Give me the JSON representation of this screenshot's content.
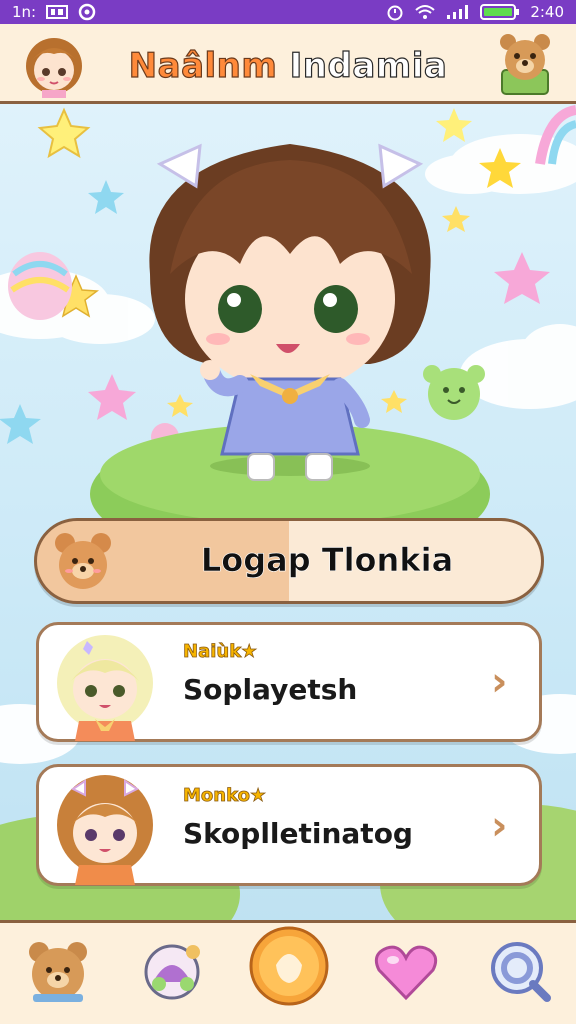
{
  "status_bar": {
    "left_text": "1n:",
    "time": "2:40"
  },
  "header": {
    "title_part1": "Naâlnm",
    "title_part2": "Indamia"
  },
  "primary_button": {
    "label": "Logap Tlonkia"
  },
  "list": [
    {
      "badge": "Naiùk★",
      "title": "Soplayetsh"
    },
    {
      "badge": "Monko★",
      "title": "Skoplletinatog"
    }
  ],
  "colors": {
    "status_bar": "#7a3cc4",
    "header_bg": "#fdf0dc",
    "border": "#8a6140",
    "accent_orange": "#ff8a3a",
    "button_fill": "#f2c79e"
  },
  "icons": {
    "header_left": "girl-avatar-icon",
    "header_right": "bear-icon",
    "nav": [
      "bear-icon",
      "game-icon",
      "egg-icon",
      "heart-icon",
      "search-icon"
    ]
  }
}
